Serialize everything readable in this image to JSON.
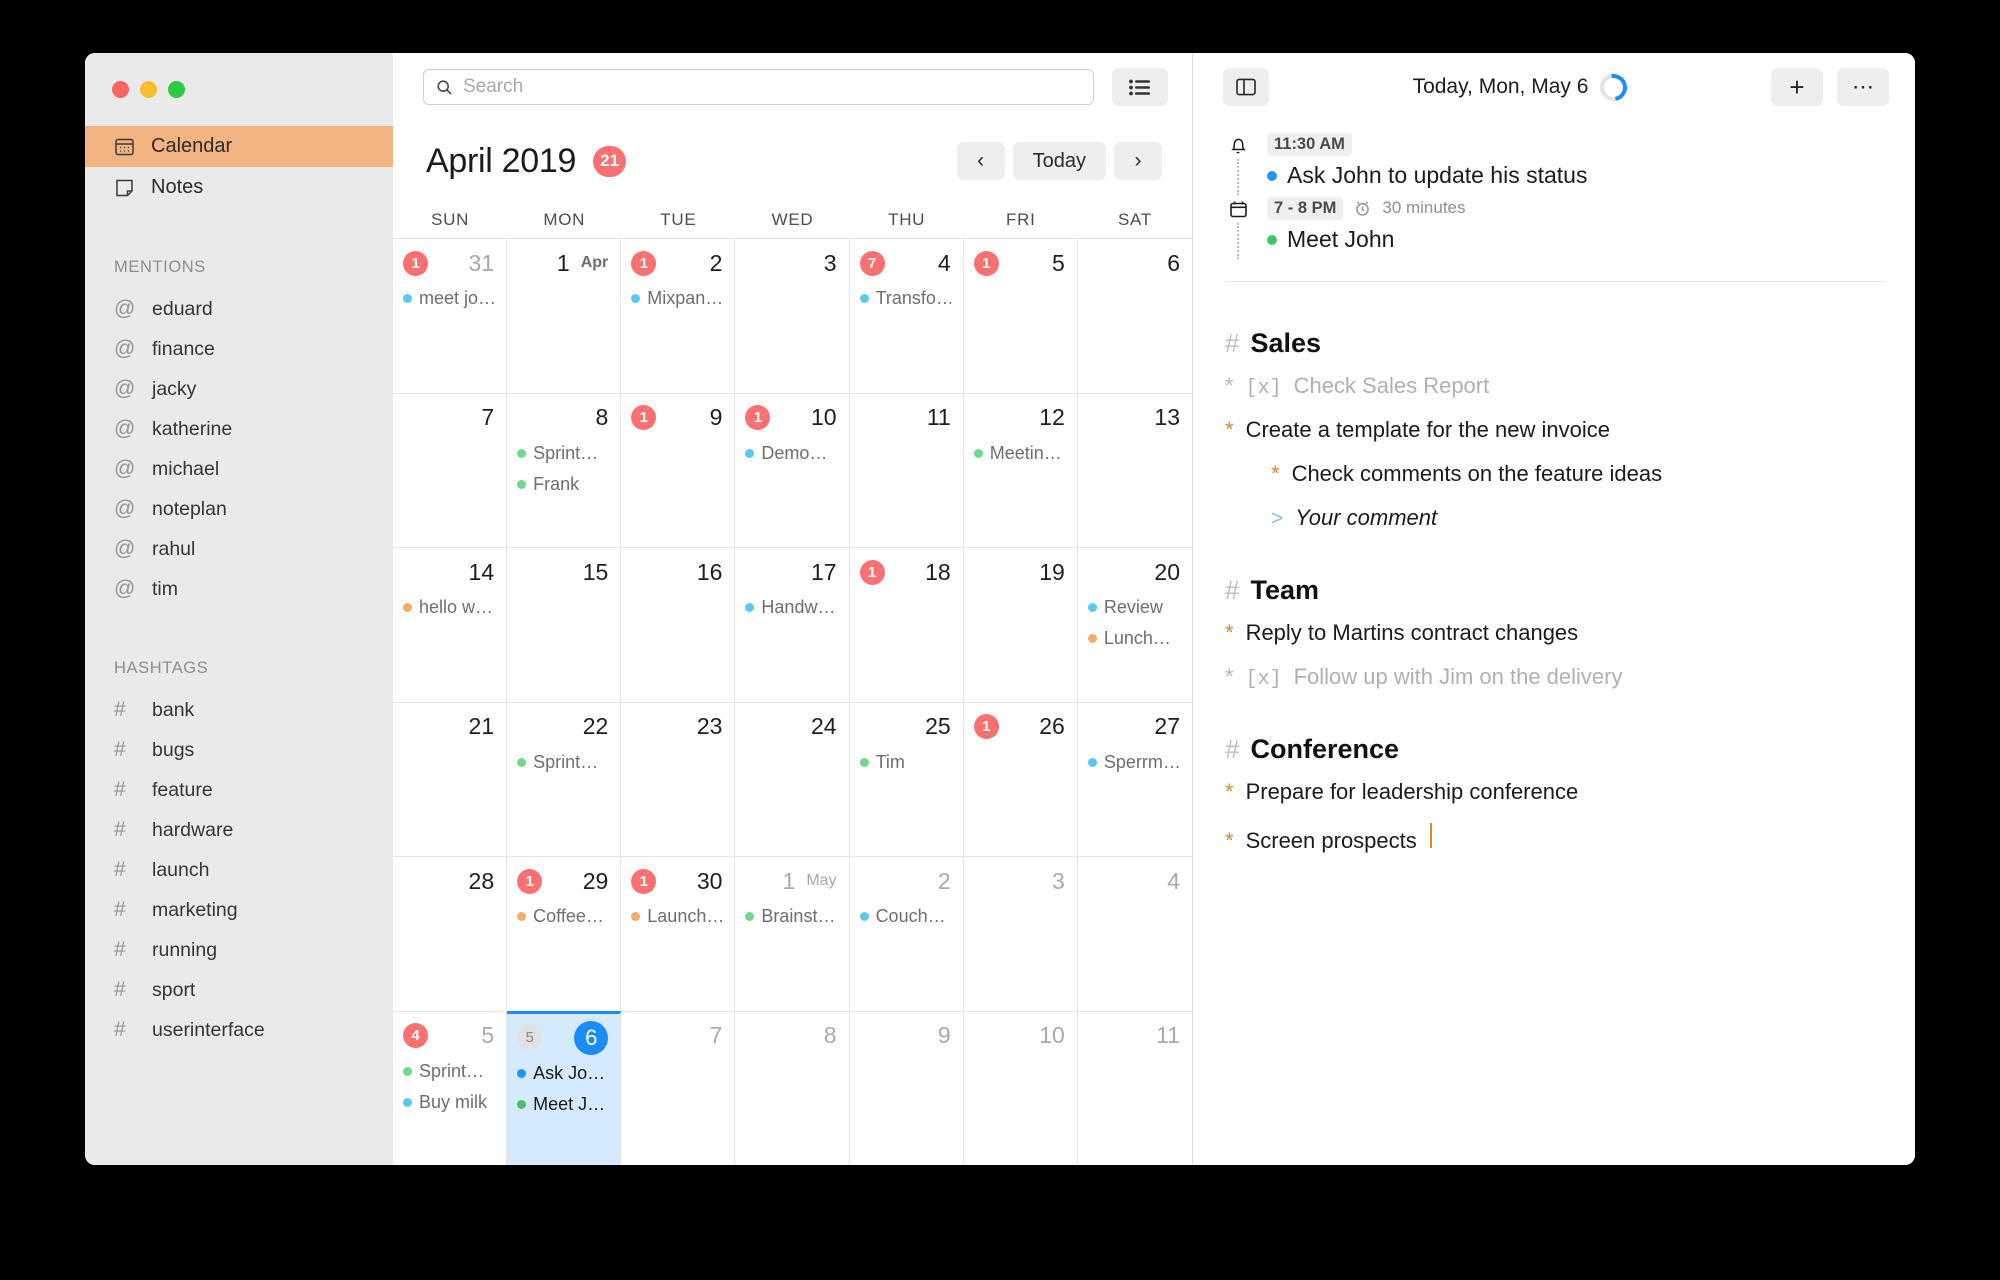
{
  "window": {
    "traffic_lights": [
      "close",
      "minimize",
      "maximize"
    ]
  },
  "sidebar": {
    "nav": [
      {
        "label": "Calendar",
        "icon": "calendar-icon",
        "active": true
      },
      {
        "label": "Notes",
        "icon": "note-icon",
        "active": false
      }
    ],
    "mentions_header": "MENTIONS",
    "mentions": [
      "eduard",
      "finance",
      "jacky",
      "katherine",
      "michael",
      "noteplan",
      "rahul",
      "tim"
    ],
    "hashtags_header": "HASHTAGS",
    "hashtags": [
      "bank",
      "bugs",
      "feature",
      "hardware",
      "launch",
      "marketing",
      "running",
      "sport",
      "userinterface"
    ]
  },
  "search": {
    "placeholder": "Search",
    "icon": "search-icon"
  },
  "calendar": {
    "list_view_icon": "list-view-icon",
    "month_title": "April 2019",
    "month_badge": "21",
    "prev_label": "‹",
    "today_label": "Today",
    "next_label": "›",
    "dow": [
      "SUN",
      "MON",
      "TUE",
      "WED",
      "THU",
      "FRI",
      "SAT"
    ],
    "weeks": [
      [
        {
          "num": "31",
          "dim": true,
          "badge": "1",
          "events": [
            {
              "title": "meet jo…",
              "color": "#5ac8f5"
            }
          ]
        },
        {
          "num": "1",
          "suffix": "Apr",
          "events": []
        },
        {
          "num": "2",
          "badge": "1",
          "events": [
            {
              "title": "Mixpan…",
              "color": "#5ac8f5"
            }
          ]
        },
        {
          "num": "3",
          "events": []
        },
        {
          "num": "4",
          "badge": "7",
          "events": [
            {
              "title": "Transfo…",
              "color": "#5ac8f5"
            }
          ]
        },
        {
          "num": "5",
          "badge": "1",
          "events": []
        },
        {
          "num": "6",
          "events": []
        }
      ],
      [
        {
          "num": "7",
          "events": []
        },
        {
          "num": "8",
          "events": [
            {
              "title": "Sprint…",
              "color": "#6ddc8a"
            },
            {
              "title": "Frank",
              "color": "#6ddc8a"
            }
          ]
        },
        {
          "num": "9",
          "badge": "1",
          "events": []
        },
        {
          "num": "10",
          "badge": "1",
          "events": [
            {
              "title": "Demo…",
              "color": "#5ac8f5"
            }
          ]
        },
        {
          "num": "11",
          "events": []
        },
        {
          "num": "12",
          "events": [
            {
              "title": "Meetin…",
              "color": "#6ddc8a"
            }
          ]
        },
        {
          "num": "13",
          "events": []
        }
      ],
      [
        {
          "num": "14",
          "events": [
            {
              "title": "hello w…",
              "color": "#f6ad63"
            }
          ]
        },
        {
          "num": "15",
          "events": []
        },
        {
          "num": "16",
          "events": []
        },
        {
          "num": "17",
          "events": [
            {
              "title": "Handw…",
              "color": "#5ac8f5"
            }
          ]
        },
        {
          "num": "18",
          "badge": "1",
          "events": []
        },
        {
          "num": "19",
          "events": []
        },
        {
          "num": "20",
          "events": [
            {
              "title": "Review",
              "color": "#5ac8f5"
            },
            {
              "title": "Lunch…",
              "color": "#f6ad63"
            }
          ]
        }
      ],
      [
        {
          "num": "21",
          "events": []
        },
        {
          "num": "22",
          "events": [
            {
              "title": "Sprint…",
              "color": "#6ddc8a"
            }
          ]
        },
        {
          "num": "23",
          "events": []
        },
        {
          "num": "24",
          "events": []
        },
        {
          "num": "25",
          "events": [
            {
              "title": "Tim",
              "color": "#6ddc8a"
            }
          ]
        },
        {
          "num": "26",
          "badge": "1",
          "events": []
        },
        {
          "num": "27",
          "events": [
            {
              "title": "Sperrm…",
              "color": "#5ac8f5"
            }
          ]
        }
      ],
      [
        {
          "num": "28",
          "events": []
        },
        {
          "num": "29",
          "badge": "1",
          "events": [
            {
              "title": "Coffee…",
              "color": "#f6ad63"
            }
          ]
        },
        {
          "num": "30",
          "badge": "1",
          "events": [
            {
              "title": "Launch…",
              "color": "#f6ad63"
            }
          ]
        },
        {
          "num": "1",
          "dim": true,
          "suffix": "May",
          "events": [
            {
              "title": "Brainst…",
              "color": "#6ddc8a"
            }
          ]
        },
        {
          "num": "2",
          "dim": true,
          "events": [
            {
              "title": "Couch…",
              "color": "#5ac8f5"
            }
          ]
        },
        {
          "num": "3",
          "dim": true,
          "events": []
        },
        {
          "num": "4",
          "dim": true,
          "events": []
        }
      ],
      [
        {
          "num": "5",
          "dim": true,
          "badge": "4",
          "events": [
            {
              "title": "Sprint…",
              "color": "#6ddc8a"
            },
            {
              "title": "Buy milk",
              "color": "#5ac8f5"
            }
          ]
        },
        {
          "num": "6",
          "today": true,
          "week_badge": "5",
          "events": [
            {
              "title": "Ask Jo…",
              "color": "#2196f3",
              "strong": true
            },
            {
              "title": "Meet J…",
              "color": "#43c463",
              "strong": true
            }
          ]
        },
        {
          "num": "7",
          "dim": true,
          "events": []
        },
        {
          "num": "8",
          "dim": true,
          "events": []
        },
        {
          "num": "9",
          "dim": true,
          "events": []
        },
        {
          "num": "10",
          "dim": true,
          "events": []
        },
        {
          "num": "11",
          "dim": true,
          "events": []
        }
      ]
    ]
  },
  "notes_panel": {
    "split_view_icon": "split-view-icon",
    "title": "Today, Mon, May 6",
    "spinner_icon": "loading-spinner-icon",
    "add_label": "+",
    "more_label": "⋯",
    "agenda": [
      {
        "icon": "bell-icon",
        "time": "11:30 AM",
        "duration": "",
        "title": "Ask John to update his status",
        "dot_color": "#2196f3"
      },
      {
        "icon": "calendar-event-icon",
        "time": "7 - 8 PM",
        "duration": "30 minutes",
        "duration_icon": "alarm-clock-icon",
        "title": "Meet John",
        "dot_color": "#43c463"
      }
    ],
    "sections": [
      {
        "hash": "#",
        "heading": "Sales",
        "tasks": [
          {
            "bullet": "*",
            "checkbox": "[x]",
            "text": "Check Sales Report",
            "done": true,
            "indent": 0
          },
          {
            "bullet": "*",
            "text": "Create a template for the new invoice",
            "done": false,
            "indent": 0
          },
          {
            "bullet": "*",
            "text": "Check comments on the feature ideas",
            "done": false,
            "indent": 1
          },
          {
            "bullet": ">",
            "text": "Your comment",
            "done": false,
            "indent": 1,
            "quote": true
          }
        ]
      },
      {
        "hash": "#",
        "heading": "Team",
        "tasks": [
          {
            "bullet": "*",
            "text": "Reply to Martins contract changes",
            "done": false,
            "indent": 0
          },
          {
            "bullet": "*",
            "checkbox": "[x]",
            "text": "Follow up with Jim on the delivery",
            "done": true,
            "indent": 0
          }
        ]
      },
      {
        "hash": "#",
        "heading": "Conference",
        "tasks": [
          {
            "bullet": "*",
            "text": "Prepare for leadership conference",
            "done": false,
            "indent": 0
          },
          {
            "bullet": "*",
            "text": "Screen prospects",
            "done": false,
            "indent": 0,
            "caret": true
          }
        ]
      }
    ]
  },
  "colors": {
    "accent_orange": "#f3b481",
    "badge_red": "#fb7070",
    "today_blue": "#1a8cfb",
    "event_blue": "#5ac8f5",
    "event_green": "#6ddc8a",
    "event_orange": "#f6ad63",
    "task_star": "#e8832a"
  }
}
